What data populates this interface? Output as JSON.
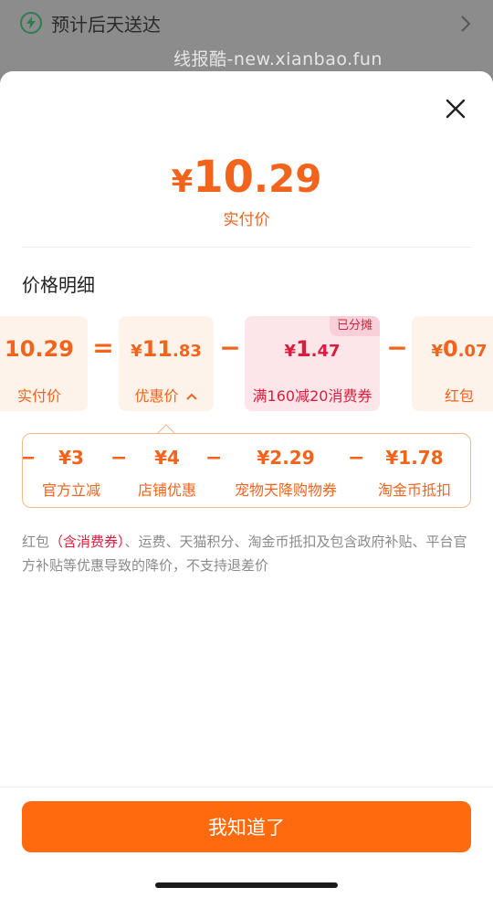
{
  "backdrop": {
    "delivery_text": "预计后天送达",
    "watermark": "线报酷-new.xianbao.fun"
  },
  "header": {
    "currency": "¥",
    "total_int": "10",
    "total_dec": ".29",
    "total_label": "实付价"
  },
  "section_title": "价格明细",
  "formula": {
    "paid": {
      "amount": "10.29",
      "label": "实付价"
    },
    "op_equals": "=",
    "discounted": {
      "currency": "¥",
      "amount_int": "11",
      "amount_dec": ".83",
      "label": "优惠价"
    },
    "op_minus_1": "−",
    "coupon": {
      "currency": "¥",
      "amount_int": "1",
      "amount_dec": ".47",
      "label": "满160减20消费券",
      "badge": "已分摊"
    },
    "op_minus_2": "−",
    "redpacket": {
      "currency": "¥",
      "amount_int": "0",
      "amount_dec": ".07",
      "label": "红包"
    }
  },
  "details": {
    "lead_op": "−",
    "items": [
      {
        "value": "¥3",
        "label": "官方立减"
      },
      {
        "value": "¥4",
        "label": "店铺优惠"
      },
      {
        "value": "¥2.29",
        "label": "宠物天降购物券"
      },
      {
        "value": "¥1.78",
        "label": "淘金币抵扣"
      }
    ],
    "op": "−"
  },
  "note": {
    "prefix": "红包",
    "highlight": "（含消费券）",
    "rest": "、运费、天猫积分、淘金币抵扣及包含政府补贴、平台官方补贴等优惠导致的降价，不支持退差价"
  },
  "button_label": "我知道了",
  "colors": {
    "accent": "#f2631c",
    "coupon": "#d81e3c",
    "button": "#ff6a0f"
  }
}
